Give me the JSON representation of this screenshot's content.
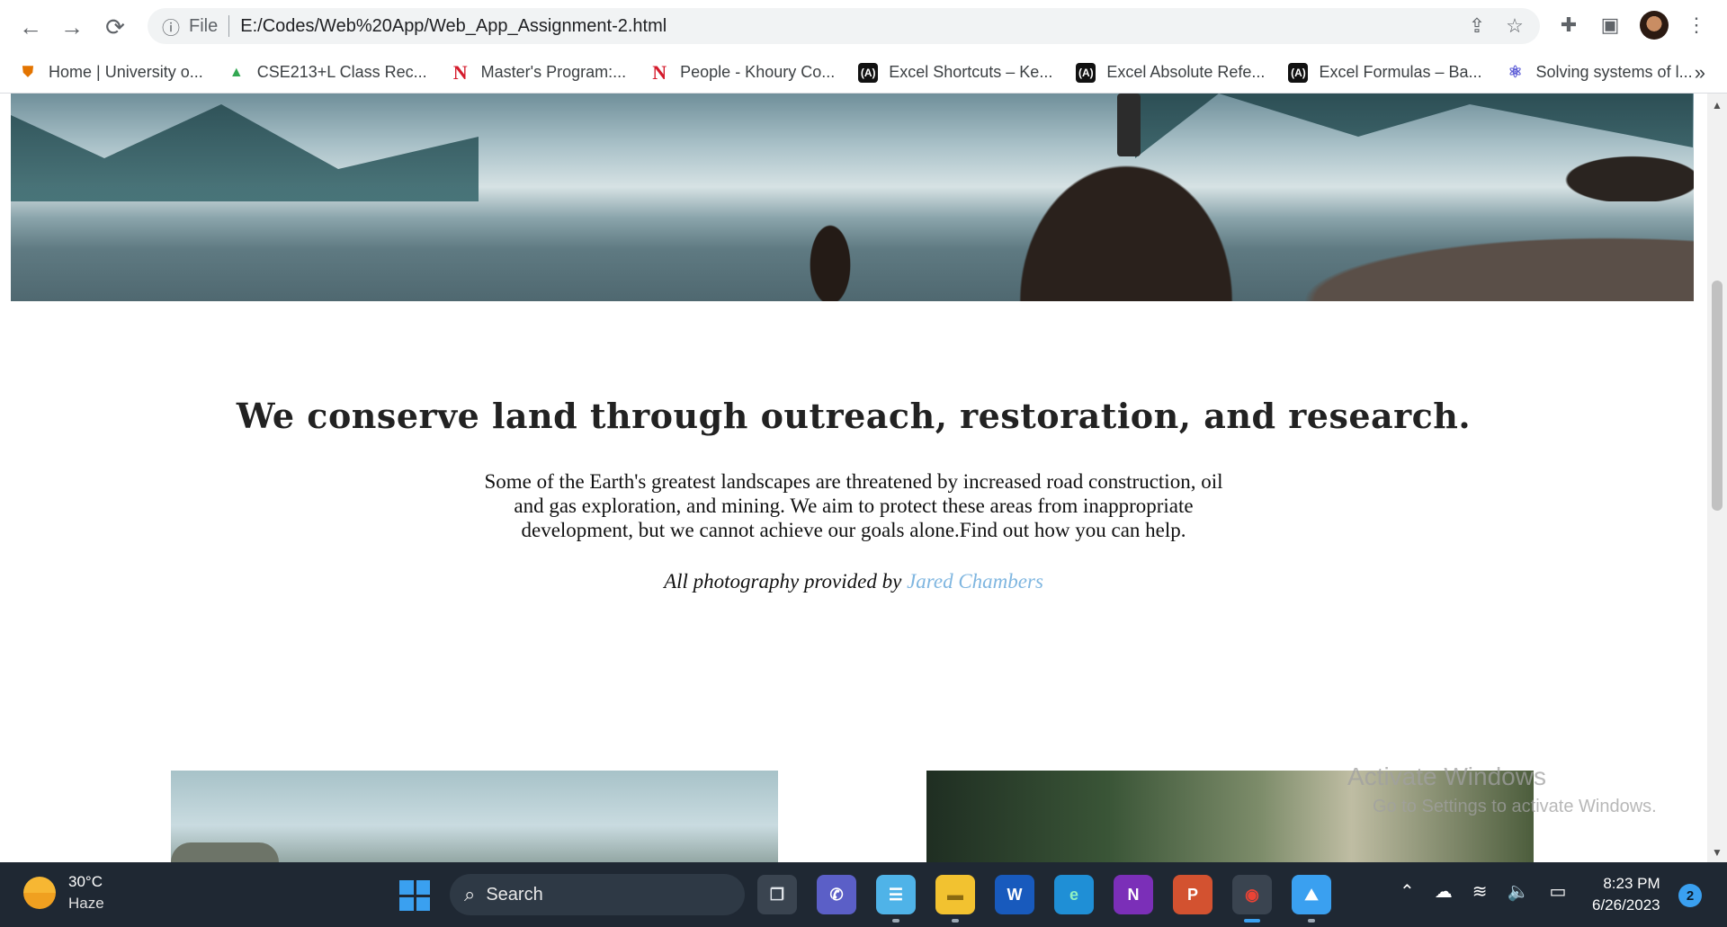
{
  "browser": {
    "back_icon": "←",
    "forward_icon": "→",
    "reload_icon": "⟳",
    "info_icon": "ⓘ",
    "file_label": "File",
    "url": "E:/Codes/Web%20App/Web_App_Assignment-2.html",
    "share_icon": "⇪",
    "star_icon": "☆",
    "extensions_icon": "✚",
    "sidepanel_icon": "▣",
    "menu_icon": "⋮",
    "more_bookmarks_icon": "»"
  },
  "bookmarks": [
    {
      "label": "Home | University o...",
      "icon": "⛊",
      "kind": "shield"
    },
    {
      "label": "CSE213+L Class Rec...",
      "icon": "▲",
      "kind": "drive"
    },
    {
      "label": "Master's Program:...",
      "icon": "N",
      "kind": "neu"
    },
    {
      "label": "People - Khoury Co...",
      "icon": "N",
      "kind": "neu"
    },
    {
      "label": "Excel Shortcuts – Ke...",
      "icon": "(A)",
      "kind": "excel"
    },
    {
      "label": "Excel Absolute Refe...",
      "icon": "(A)",
      "kind": "excel"
    },
    {
      "label": "Excel Formulas – Ba...",
      "icon": "(A)",
      "kind": "excel"
    },
    {
      "label": "Solving systems of l...",
      "icon": "⚛",
      "kind": "atom"
    }
  ],
  "page": {
    "headline": "We conserve land through outreach, restoration, and research.",
    "body": "Some of the Earth's greatest landscapes are threatened by increased road construction, oil and gas exploration, and mining. We aim to protect these areas from inappropriate development, but we cannot achieve our goals alone.Find out how you can help.",
    "credit_prefix": "All photography provided by",
    "credit_name": "Jared Chambers"
  },
  "watermark": {
    "line1": "Activate Windows",
    "line2": "Go to Settings to activate Windows."
  },
  "taskbar": {
    "temperature": "30°C",
    "condition": "Haze",
    "search_label": "Search",
    "search_icon": "⌕",
    "apps": [
      {
        "name": "task-view",
        "glyph": "❐",
        "bg": "#3a4450",
        "fg": "#dfe3e8"
      },
      {
        "name": "teams",
        "glyph": "✆",
        "bg": "#5b5fc7",
        "fg": "#ffffff"
      },
      {
        "name": "notepad",
        "glyph": "☰",
        "bg": "#4fb3e8",
        "fg": "#ffffff"
      },
      {
        "name": "file-explorer",
        "glyph": "▬",
        "bg": "#f2c230",
        "fg": "#8a6a10"
      },
      {
        "name": "word",
        "glyph": "W",
        "bg": "#185abd",
        "fg": "#ffffff"
      },
      {
        "name": "edge",
        "glyph": "e",
        "bg": "#1f8fd6",
        "fg": "#8ff0c0"
      },
      {
        "name": "onenote",
        "glyph": "N",
        "bg": "#7b2fb8",
        "fg": "#ffffff"
      },
      {
        "name": "powerpoint",
        "glyph": "P",
        "bg": "#d35230",
        "fg": "#ffffff"
      },
      {
        "name": "chrome",
        "glyph": "◉",
        "bg": "#3a4450",
        "fg": "#ea4335"
      },
      {
        "name": "photos",
        "glyph": "⛰",
        "bg": "#3aa0f0",
        "fg": "#ffffff"
      }
    ],
    "tray": {
      "chevron_icon": "⌃",
      "cloud_icon": "☁",
      "wifi_icon": "≋",
      "volume_icon": "🔈",
      "battery_icon": "▭"
    },
    "time": "8:23 PM",
    "date": "6/26/2023",
    "notification_count": "2"
  }
}
